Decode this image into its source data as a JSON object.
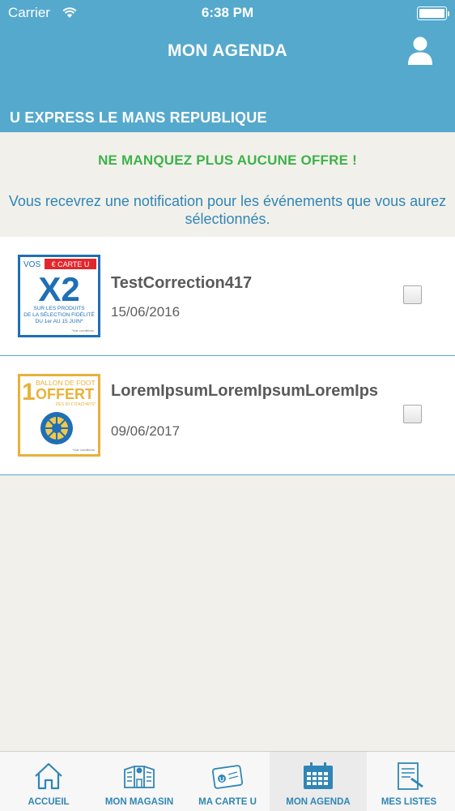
{
  "status_bar": {
    "carrier": "Carrier",
    "time": "6:38 PM"
  },
  "header": {
    "title": "MON AGENDA",
    "store": "U EXPRESS LE MANS REPUBLIQUE"
  },
  "banner": {
    "title": "NE MANQUEZ PLUS AUCUNE OFFRE !",
    "text": "Vous recevrez une notification pour les événements que vous aurez sélectionnés."
  },
  "events": [
    {
      "title": "TestCorrection417",
      "date": "15/06/2016",
      "checked": false,
      "thumb": {
        "top": "VOS",
        "badge": "€ CARTE U",
        "big": "X2",
        "line1": "SUR LES PRODUITS",
        "line2": "DE LA SÉLECTION FIDÉLITÉ",
        "line3": "DU 1er AU 15 JUIN*",
        "note": "*Voir conditions."
      }
    },
    {
      "title": "LoremIpsumLoremIpsumLoremIpsumLoremIpsumLoremIpsumLoremIpsum",
      "date": "09/06/2017",
      "checked": false,
      "thumb": {
        "num": "1",
        "top": "BALLON DE FOOT",
        "big": "OFFERT",
        "sub": "DÈS 50 € D'ACHATS*",
        "note": "*Voir conditions."
      }
    }
  ],
  "tabs": [
    {
      "label": "ACCUEIL",
      "icon": "home-icon"
    },
    {
      "label": "MON MAGASIN",
      "icon": "store-icon"
    },
    {
      "label": "MA CARTE U",
      "icon": "card-icon"
    },
    {
      "label": "MON AGENDA",
      "icon": "calendar-icon",
      "active": true
    },
    {
      "label": "MES LISTES",
      "icon": "list-icon"
    }
  ],
  "colors": {
    "header": "#55a9cd",
    "accent": "#2f86b6",
    "offer_green": "#3db24a",
    "promo_blue": "#1f6fb6",
    "promo_red": "#e3262c",
    "promo_yellow": "#e8b13a"
  }
}
